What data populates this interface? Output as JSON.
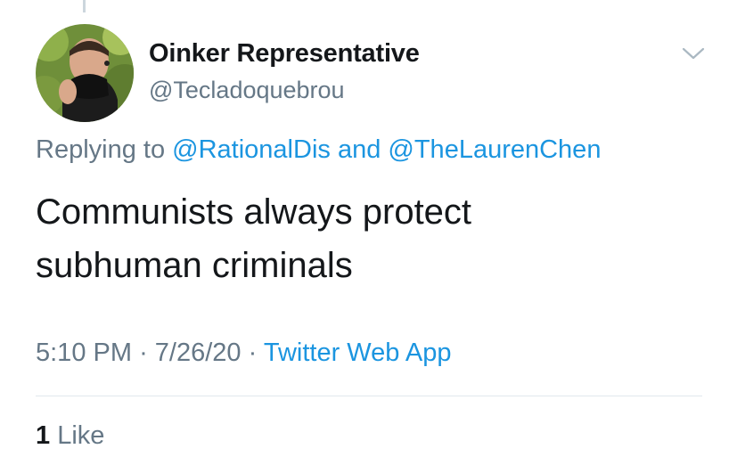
{
  "tweet": {
    "author": {
      "display_name": "Oinker Representative",
      "handle": "@Tecladoquebrou",
      "avatar_icon": "profile-photo"
    },
    "menu_icon": "chevron-down-icon",
    "replying": {
      "prefix": "Replying to",
      "mention_1": "@RationalDis",
      "conjunction": "and",
      "mention_2": "@TheLaurenChen"
    },
    "text_lines": [
      "Communists always protect",
      "subhuman criminals"
    ],
    "time": "5:10 PM",
    "separator": "·",
    "date": "7/26/20",
    "source": "Twitter Web App",
    "likes": {
      "count": "1",
      "label": "Like"
    }
  },
  "colors": {
    "primary_text": "#14171a",
    "secondary_text": "#657786",
    "link": "#1b95e0",
    "divider": "#e1e8ed",
    "thread_line": "#ccd6dd"
  }
}
